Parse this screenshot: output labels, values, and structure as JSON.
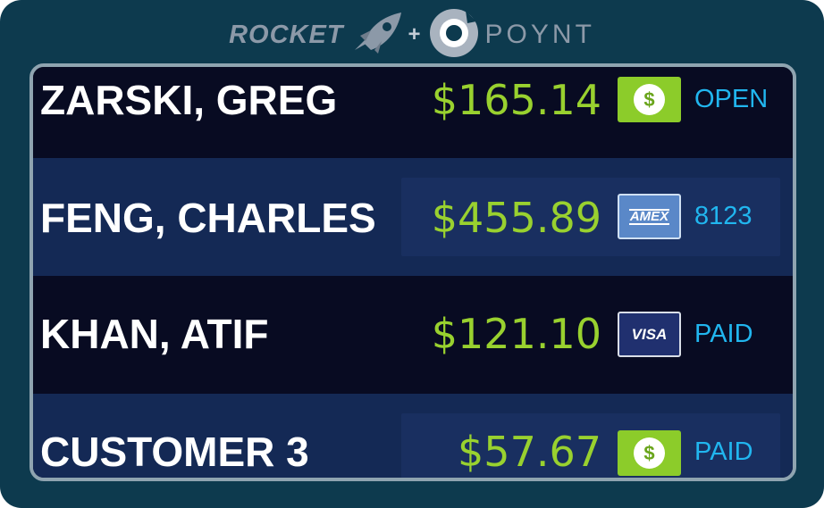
{
  "header": {
    "brand_left": "ROCKET",
    "plus": "+",
    "brand_right": "POYNT"
  },
  "colors": {
    "frame": "#0d3a4e",
    "amount": "#99d12f",
    "status": "#21b6ef",
    "cash_badge": "#8ccc2a"
  },
  "rows": [
    {
      "name": "ZARSKI, GREG",
      "amount": "$165.14",
      "payment_icon": "cash-icon",
      "payment_label": "$",
      "status": "OPEN"
    },
    {
      "name": "FENG, CHARLES",
      "amount": "$455.89",
      "payment_icon": "amex-icon",
      "payment_label": "AMEX",
      "status": "8123"
    },
    {
      "name": "KHAN, ATIF",
      "amount": "$121.10",
      "payment_icon": "visa-icon",
      "payment_label": "VISA",
      "status": "PAID"
    },
    {
      "name": "CUSTOMER 3",
      "amount": "$57.67",
      "payment_icon": "cash-icon",
      "payment_label": "$",
      "status": "PAID"
    }
  ]
}
